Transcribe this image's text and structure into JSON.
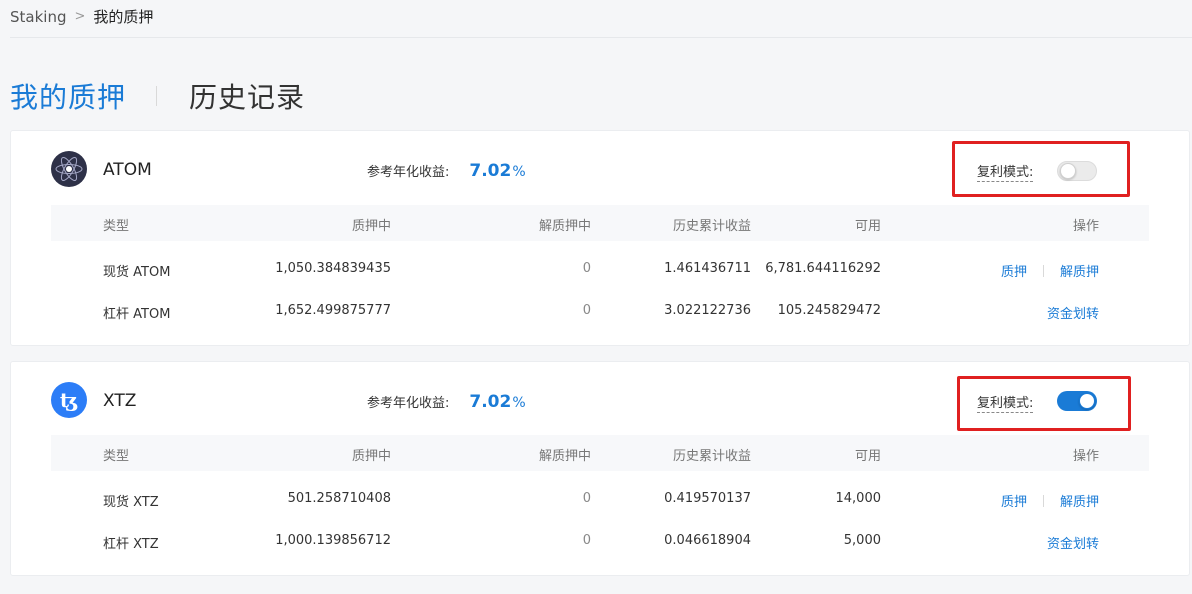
{
  "breadcrumb": {
    "root": "Staking",
    "separator": ">",
    "current": "我的质押"
  },
  "tabs": [
    {
      "label": "我的质押",
      "active": true
    },
    {
      "label": "历史记录",
      "active": false
    }
  ],
  "table_headers": {
    "type": "类型",
    "staking": "质押中",
    "unstaking": "解质押中",
    "earnings": "历史累计收益",
    "available": "可用",
    "ops": "操作"
  },
  "apy_label": "参考年化收益:",
  "compound_label": "复利模式:",
  "actions": {
    "stake": "质押",
    "unstake": "解质押",
    "transfer": "资金划转"
  },
  "colors": {
    "accent": "#1a7bd6",
    "highlight": "#e02020"
  },
  "cards": [
    {
      "name": "ATOM",
      "icon": "cosmos-atom-icon",
      "apy_value": "7.02",
      "apy_unit": "%",
      "compound_on": false,
      "rows": [
        {
          "type": "现货 ATOM",
          "staking": "1,050.384839435",
          "unstaking": "0",
          "earnings": "1.461436711",
          "available": "6,781.644116292"
        },
        {
          "type": "杠杆 ATOM",
          "staking": "1,652.499875777",
          "unstaking": "0",
          "earnings": "3.022122736",
          "available": "105.245829472"
        }
      ]
    },
    {
      "name": "XTZ",
      "icon": "tezos-xtz-icon",
      "apy_value": "7.02",
      "apy_unit": "%",
      "compound_on": true,
      "rows": [
        {
          "type": "现货 XTZ",
          "staking": "501.258710408",
          "unstaking": "0",
          "earnings": "0.419570137",
          "available": "14,000"
        },
        {
          "type": "杠杆 XTZ",
          "staking": "1,000.139856712",
          "unstaking": "0",
          "earnings": "0.046618904",
          "available": "5,000"
        }
      ]
    }
  ]
}
